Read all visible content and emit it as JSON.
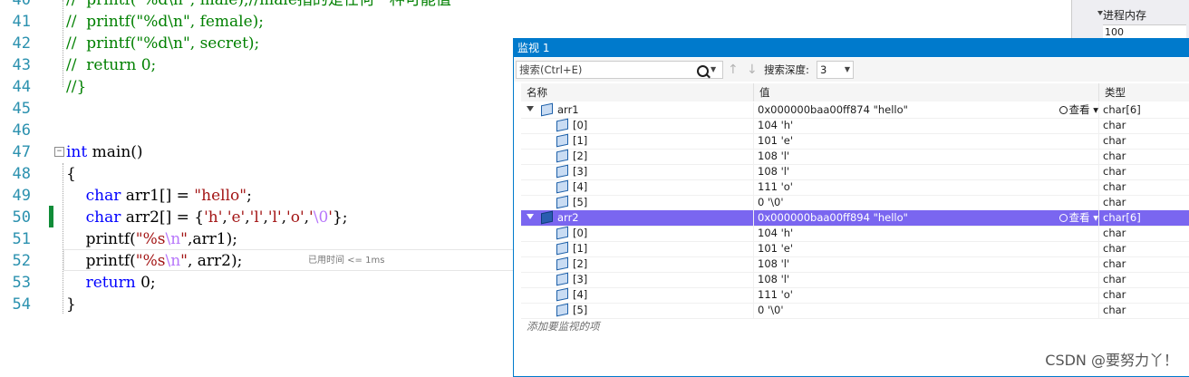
{
  "editor": {
    "lines": [
      {
        "num": "40",
        "segs": [
          {
            "t": "//  printf(\"%d\\n\", male);//male指的是任何一种可能值",
            "c": "cm"
          }
        ]
      },
      {
        "num": "41",
        "segs": [
          {
            "t": "//  printf(\"%d\\n\", female);",
            "c": "cm"
          }
        ]
      },
      {
        "num": "42",
        "segs": [
          {
            "t": "//  printf(\"%d\\n\", secret);",
            "c": "cm"
          }
        ]
      },
      {
        "num": "43",
        "segs": [
          {
            "t": "//  return 0;",
            "c": "cm"
          }
        ]
      },
      {
        "num": "44",
        "segs": [
          {
            "t": "//}",
            "c": "cm"
          }
        ]
      },
      {
        "num": "45",
        "segs": []
      },
      {
        "num": "46",
        "segs": []
      },
      {
        "num": "47",
        "segs": [
          {
            "t": "int",
            "c": "kw"
          },
          {
            "t": " main()",
            "c": ""
          }
        ]
      },
      {
        "num": "48",
        "segs": [
          {
            "t": "{",
            "c": ""
          }
        ]
      },
      {
        "num": "49",
        "segs": [
          {
            "t": "    ",
            "c": ""
          },
          {
            "t": "char",
            "c": "kw"
          },
          {
            "t": " arr1[] = ",
            "c": ""
          },
          {
            "t": "\"hello\"",
            "c": "st"
          },
          {
            "t": ";",
            "c": ""
          }
        ]
      },
      {
        "num": "50",
        "segs": [
          {
            "t": "    ",
            "c": ""
          },
          {
            "t": "char",
            "c": "kw"
          },
          {
            "t": " arr2[] = {",
            "c": ""
          },
          {
            "t": "'h'",
            "c": "st"
          },
          {
            "t": ",",
            "c": ""
          },
          {
            "t": "'e'",
            "c": "st"
          },
          {
            "t": ",",
            "c": ""
          },
          {
            "t": "'l'",
            "c": "st"
          },
          {
            "t": ",",
            "c": ""
          },
          {
            "t": "'l'",
            "c": "st"
          },
          {
            "t": ",",
            "c": ""
          },
          {
            "t": "'o'",
            "c": "st"
          },
          {
            "t": ",",
            "c": ""
          },
          {
            "t": "'",
            "c": "st"
          },
          {
            "t": "\\0",
            "c": "es"
          },
          {
            "t": "'",
            "c": "st"
          },
          {
            "t": "};",
            "c": ""
          }
        ]
      },
      {
        "num": "51",
        "segs": [
          {
            "t": "    printf(",
            "c": ""
          },
          {
            "t": "\"%s",
            "c": "st"
          },
          {
            "t": "\\n",
            "c": "es"
          },
          {
            "t": "\"",
            "c": "st"
          },
          {
            "t": ",arr1);",
            "c": ""
          }
        ]
      },
      {
        "num": "52",
        "segs": [
          {
            "t": "    printf(",
            "c": ""
          },
          {
            "t": "\"%s",
            "c": "st"
          },
          {
            "t": "\\n",
            "c": "es"
          },
          {
            "t": "\"",
            "c": "st"
          },
          {
            "t": ", arr2);",
            "c": ""
          }
        ]
      },
      {
        "num": "53",
        "segs": [
          {
            "t": "    ",
            "c": ""
          },
          {
            "t": "return",
            "c": "kw"
          },
          {
            "t": " 0;",
            "c": ""
          }
        ]
      },
      {
        "num": "54",
        "segs": [
          {
            "t": "}",
            "c": ""
          }
        ]
      }
    ],
    "perf_tip": "已用时间 <= 1ms",
    "collapse_glyph": "⊟"
  },
  "right_dock": {
    "title": "进程内存",
    "value": "100"
  },
  "watch": {
    "title": "监视 1",
    "search_placeholder": "搜索(Ctrl+E)",
    "search_drop": "▼",
    "back_arrow": "↑",
    "fwd_arrow": "↓",
    "depth_label": "搜索深度:",
    "depth_value": "3",
    "depth_drop": "▼",
    "columns": {
      "name": "名称",
      "value": "值",
      "type": "类型"
    },
    "view_label": "查看",
    "view_drop": "▾",
    "rows": [
      {
        "name": "arr1",
        "value": "0x000000baa00ff874 \"hello\"",
        "type": "char[6]",
        "level": 0,
        "expanded": true,
        "selected": false,
        "view": true
      },
      {
        "name": "[0]",
        "value": "104 'h'",
        "type": "char",
        "level": 1
      },
      {
        "name": "[1]",
        "value": "101 'e'",
        "type": "char",
        "level": 1
      },
      {
        "name": "[2]",
        "value": "108 'l'",
        "type": "char",
        "level": 1
      },
      {
        "name": "[3]",
        "value": "108 'l'",
        "type": "char",
        "level": 1
      },
      {
        "name": "[4]",
        "value": "111 'o'",
        "type": "char",
        "level": 1
      },
      {
        "name": "[5]",
        "value": "0 '\\0'",
        "type": "char",
        "level": 1
      },
      {
        "name": "arr2",
        "value": "0x000000baa00ff894 \"hello\"",
        "type": "char[6]",
        "level": 0,
        "expanded": true,
        "selected": true,
        "view": true
      },
      {
        "name": "[0]",
        "value": "104 'h'",
        "type": "char",
        "level": 1
      },
      {
        "name": "[1]",
        "value": "101 'e'",
        "type": "char",
        "level": 1
      },
      {
        "name": "[2]",
        "value": "108 'l'",
        "type": "char",
        "level": 1
      },
      {
        "name": "[3]",
        "value": "108 'l'",
        "type": "char",
        "level": 1
      },
      {
        "name": "[4]",
        "value": "111 'o'",
        "type": "char",
        "level": 1
      },
      {
        "name": "[5]",
        "value": "0 '\\0'",
        "type": "char",
        "level": 1
      }
    ],
    "add_item_label": "添加要监视的项"
  },
  "watermark": "CSDN @要努力丫！",
  "colors": {
    "accent": "#007acc",
    "selection": "#7a66f0",
    "line_numbers": "#2b91af",
    "keyword": "#0000ff",
    "string": "#a31515",
    "comment": "#008000",
    "change_bar": "#108c38"
  }
}
